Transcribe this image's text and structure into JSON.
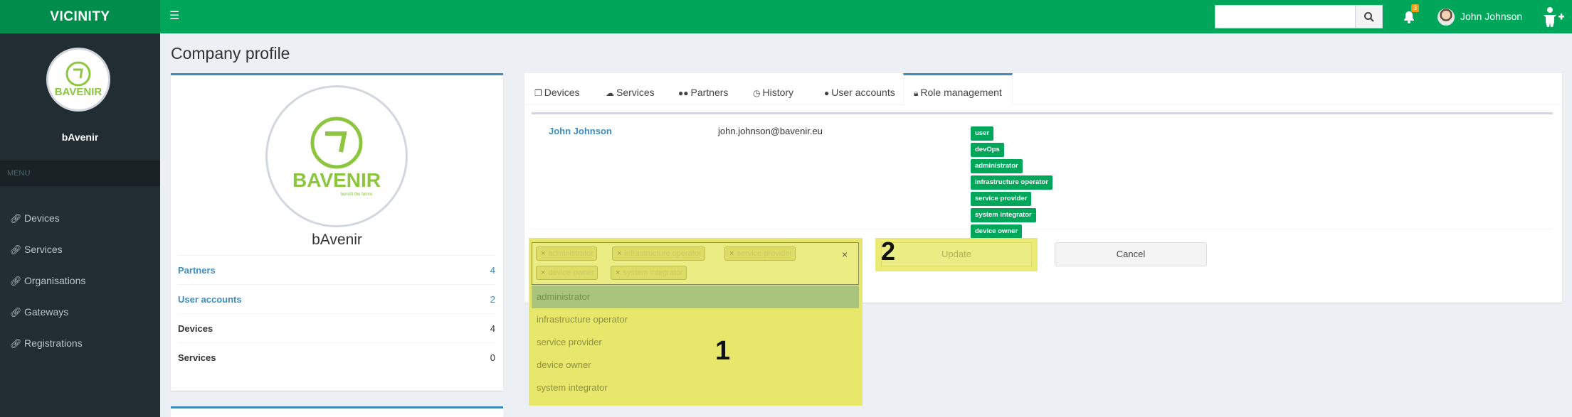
{
  "header": {
    "app_name": "VICINITY",
    "search_placeholder": "",
    "notification_count": "3",
    "user_name": "John Johnson"
  },
  "sidebar": {
    "org_name": "bAvenir",
    "menu_header": "MENU",
    "items": [
      {
        "label": "Devices",
        "icon": "link-icon"
      },
      {
        "label": "Services",
        "icon": "link-icon"
      },
      {
        "label": "Organisations",
        "icon": "link-icon"
      },
      {
        "label": "Gateways",
        "icon": "link-icon"
      },
      {
        "label": "Registrations",
        "icon": "link-icon"
      }
    ]
  },
  "page": {
    "title": "Company profile"
  },
  "profile": {
    "logo_text": "BAVENIR",
    "logo_tagline": "benefit the future",
    "name": "bAvenir",
    "stats": [
      {
        "label": "Partners",
        "value": "4",
        "link": true
      },
      {
        "label": "User accounts",
        "value": "2",
        "link": true
      },
      {
        "label": "Devices",
        "value": "4",
        "link": false
      },
      {
        "label": "Services",
        "value": "0",
        "link": false
      }
    ]
  },
  "tabs": [
    {
      "label": "Devices",
      "icon": "copy-icon"
    },
    {
      "label": "Services",
      "icon": "cloud-icon"
    },
    {
      "label": "Partners",
      "icon": "users-icon"
    },
    {
      "label": "History",
      "icon": "clock-icon"
    },
    {
      "label": "User accounts",
      "icon": "user-icon"
    },
    {
      "label": "Role management",
      "icon": "lock-icon",
      "active": true
    }
  ],
  "role_management": {
    "user_name": "John Johnson",
    "user_email": "john.johnson@bavenir.eu",
    "roles": [
      "user",
      "devOps",
      "administrator",
      "infrastructure operator",
      "service provider",
      "system integrator",
      "device owner"
    ],
    "selected_tags": [
      "administrator",
      "infrastructure operator",
      "service provider",
      "device owner",
      "system integrator"
    ],
    "clear_symbol": "×",
    "tag_remove_symbol": "×",
    "dropdown_options": [
      "administrator",
      "infrastructure operator",
      "service provider",
      "device owner",
      "system integrator"
    ],
    "update_label": "Update",
    "cancel_label": "Cancel"
  },
  "annotations": {
    "marker_1": "1",
    "marker_2": "2"
  },
  "colors": {
    "brand_green": "#00a65a",
    "sidebar_dark": "#222d32",
    "link_blue": "#3c8dbc",
    "highlight_yellow": "#e7e76c"
  }
}
